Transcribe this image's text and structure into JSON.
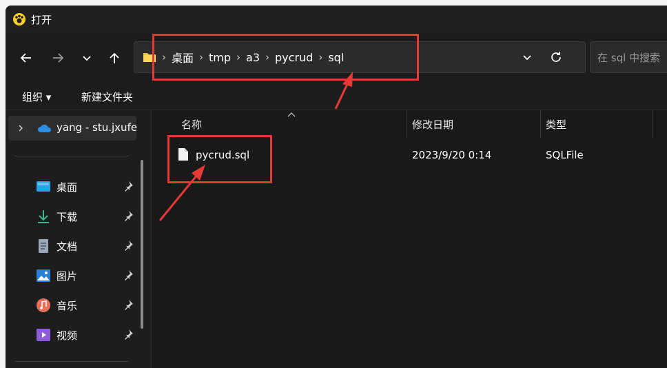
{
  "window": {
    "title": "打开",
    "app_icon": "pawprint-icon"
  },
  "nav": {
    "back_icon": "arrow-left-icon",
    "forward_icon": "arrow-right-icon",
    "recent_icon": "chevron-down-icon",
    "up_icon": "arrow-up-icon"
  },
  "address_bar": {
    "folder_icon": "folder-icon",
    "breadcrumbs": [
      "桌面",
      "tmp",
      "a3",
      "pycrud",
      "sql"
    ],
    "separator": "›",
    "refresh_icon": "refresh-icon"
  },
  "search": {
    "placeholder": "在 sql 中搜索"
  },
  "command_bar": {
    "organize_label": "组织 ▾",
    "new_folder_label": "新建文件夹"
  },
  "sidebar": {
    "cloud_item_label": "yang - stu.jxufe",
    "quick_access": [
      {
        "label": "桌面",
        "icon": "desktop-icon",
        "color": "#29a3e6"
      },
      {
        "label": "下载",
        "icon": "download-icon",
        "color": "#3fb68b"
      },
      {
        "label": "文档",
        "icon": "document-icon",
        "color": "#9aa7b8"
      },
      {
        "label": "图片",
        "icon": "picture-icon",
        "color": "#2b7fd8"
      },
      {
        "label": "音乐",
        "icon": "music-icon",
        "color": "#e8705a"
      },
      {
        "label": "视频",
        "icon": "video-icon",
        "color": "#8b5cd6"
      }
    ]
  },
  "file_list": {
    "columns": [
      "名称",
      "修改日期",
      "类型"
    ],
    "rows": [
      {
        "name": "pycrud.sql",
        "modified": "2023/9/20 0:14",
        "type": "SQLFile"
      }
    ]
  },
  "colors": {
    "annotation_red": "#e53935",
    "window_bg": "#202020"
  }
}
